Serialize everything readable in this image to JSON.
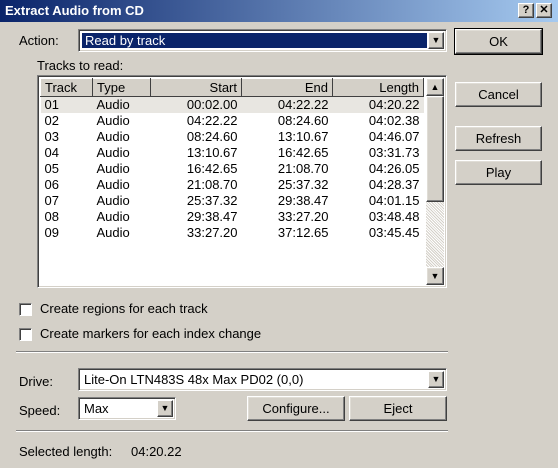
{
  "window": {
    "title": "Extract Audio from CD",
    "help_label": "?",
    "close_label": "✕"
  },
  "action": {
    "label": "Action:",
    "value": "Read by track"
  },
  "tracks": {
    "group_label": "Tracks to read:",
    "columns": [
      "Track",
      "Type",
      "Start",
      "End",
      "Length"
    ],
    "rows": [
      [
        "01",
        "Audio",
        "00:02.00",
        "04:22.22",
        "04:20.22"
      ],
      [
        "02",
        "Audio",
        "04:22.22",
        "08:24.60",
        "04:02.38"
      ],
      [
        "03",
        "Audio",
        "08:24.60",
        "13:10.67",
        "04:46.07"
      ],
      [
        "04",
        "Audio",
        "13:10.67",
        "16:42.65",
        "03:31.73"
      ],
      [
        "05",
        "Audio",
        "16:42.65",
        "21:08.70",
        "04:26.05"
      ],
      [
        "06",
        "Audio",
        "21:08.70",
        "25:37.32",
        "04:28.37"
      ],
      [
        "07",
        "Audio",
        "25:37.32",
        "29:38.47",
        "04:01.15"
      ],
      [
        "08",
        "Audio",
        "29:38.47",
        "33:27.20",
        "03:48.48"
      ],
      [
        "09",
        "Audio",
        "33:27.20",
        "37:12.65",
        "03:45.45"
      ]
    ]
  },
  "checkboxes": {
    "regions": "Create regions for each track",
    "markers": "Create markers for each index change"
  },
  "drive": {
    "label": "Drive:",
    "value": "Lite-On LTN483S 48x Max PD02 (0,0)"
  },
  "speed": {
    "label": "Speed:",
    "value": "Max"
  },
  "buttons": {
    "ok": "OK",
    "cancel": "Cancel",
    "refresh": "Refresh",
    "play": "Play",
    "configure": "Configure...",
    "eject": "Eject"
  },
  "status": {
    "selected_length_label": "Selected length:",
    "selected_length_value": "04:20.22"
  },
  "colors": {
    "title_start": "#0a246a",
    "title_end": "#a6caf0",
    "selection": "#0a246a",
    "face": "#d4d0c8"
  }
}
